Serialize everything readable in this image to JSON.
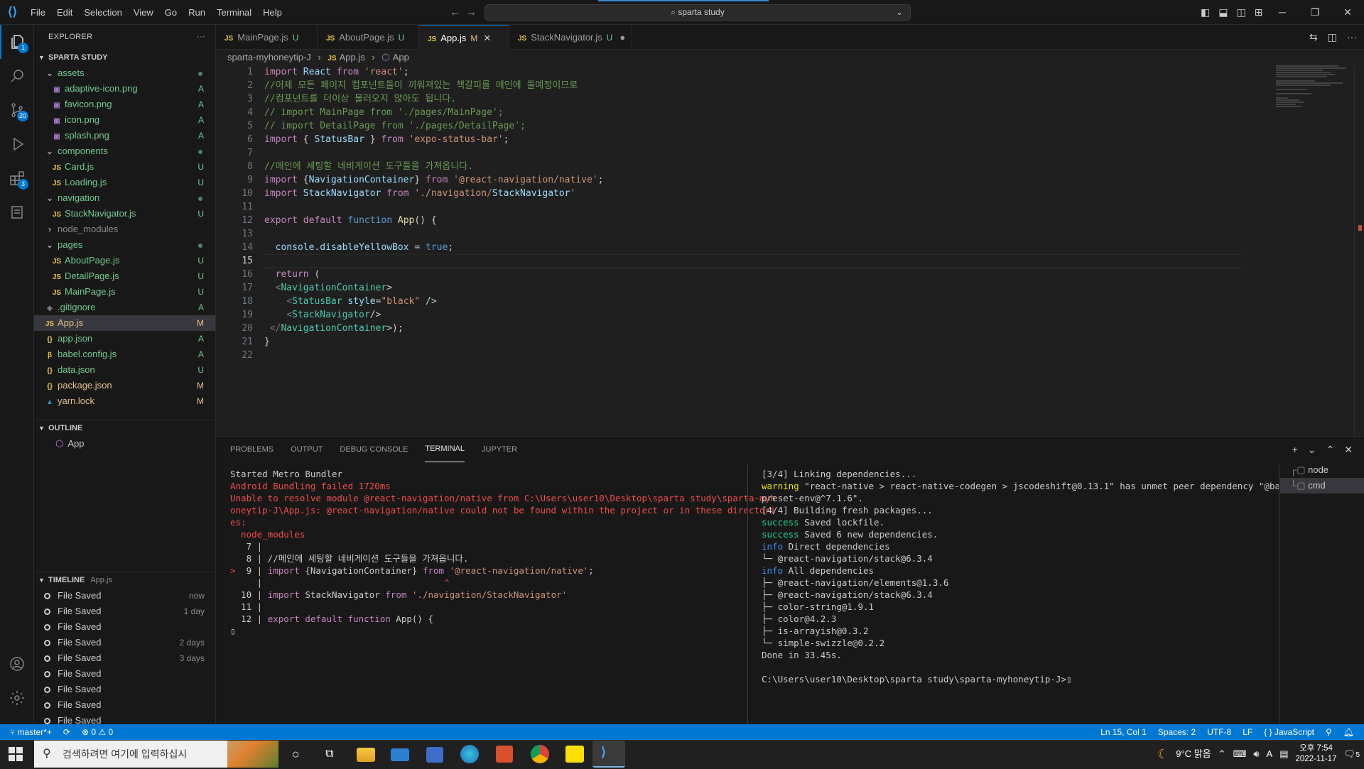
{
  "titlebar": {
    "menu": [
      "File",
      "Edit",
      "Selection",
      "View",
      "Go",
      "Run",
      "Terminal",
      "Help"
    ],
    "search_text": "sparta study"
  },
  "activity": {
    "explorer_badge": "1",
    "scm_badge": "20",
    "extensions_badge": "3"
  },
  "explorer": {
    "header": "EXPLORER",
    "section": "SPARTA STUDY",
    "files": [
      {
        "name": "assets",
        "icon": "folder",
        "status": "dot",
        "indent": 1,
        "kind": "folder-open"
      },
      {
        "name": "adaptive-icon.png",
        "icon": "png",
        "status": "A",
        "indent": 2
      },
      {
        "name": "favicon.png",
        "icon": "png",
        "status": "A",
        "indent": 2
      },
      {
        "name": "icon.png",
        "icon": "png",
        "status": "A",
        "indent": 2
      },
      {
        "name": "splash.png",
        "icon": "png",
        "status": "A",
        "indent": 2
      },
      {
        "name": "components",
        "icon": "folder",
        "status": "dot",
        "indent": 1,
        "kind": "folder-open"
      },
      {
        "name": "Card.js",
        "icon": "js",
        "status": "U",
        "indent": 2
      },
      {
        "name": "Loading.js",
        "icon": "js",
        "status": "U",
        "indent": 2
      },
      {
        "name": "navigation",
        "icon": "folder",
        "status": "dot",
        "indent": 1,
        "kind": "folder-open"
      },
      {
        "name": "StackNavigator.js",
        "icon": "js",
        "status": "U",
        "indent": 2
      },
      {
        "name": "node_modules",
        "icon": "folder",
        "status": "",
        "indent": 1,
        "kind": "folder-closed"
      },
      {
        "name": "pages",
        "icon": "folder",
        "status": "dot",
        "indent": 1,
        "kind": "folder-open"
      },
      {
        "name": "AboutPage.js",
        "icon": "js",
        "status": "U",
        "indent": 2
      },
      {
        "name": "DetailPage.js",
        "icon": "js",
        "status": "U",
        "indent": 2
      },
      {
        "name": "MainPage.js",
        "icon": "js",
        "status": "U",
        "indent": 2
      },
      {
        "name": ".gitignore",
        "icon": "git",
        "status": "A",
        "indent": 1
      },
      {
        "name": "App.js",
        "icon": "js",
        "status": "M",
        "indent": 1,
        "selected": true
      },
      {
        "name": "app.json",
        "icon": "json",
        "status": "A",
        "indent": 1
      },
      {
        "name": "babel.config.js",
        "icon": "babel",
        "status": "A",
        "indent": 1
      },
      {
        "name": "data.json",
        "icon": "json",
        "status": "U",
        "indent": 1
      },
      {
        "name": "package.json",
        "icon": "json",
        "status": "M",
        "indent": 1
      },
      {
        "name": "yarn.lock",
        "icon": "yarn",
        "status": "M",
        "indent": 1
      }
    ],
    "outline_header": "OUTLINE",
    "outline_item": "App",
    "timeline_header": "TIMELINE",
    "timeline_file": "App.js",
    "timeline": [
      {
        "label": "File Saved",
        "when": "now"
      },
      {
        "label": "File Saved",
        "when": "1 day"
      },
      {
        "label": "File Saved",
        "when": ""
      },
      {
        "label": "File Saved",
        "when": "2 days"
      },
      {
        "label": "File Saved",
        "when": "3 days"
      },
      {
        "label": "File Saved",
        "when": ""
      },
      {
        "label": "File Saved",
        "when": ""
      },
      {
        "label": "File Saved",
        "when": ""
      },
      {
        "label": "File Saved",
        "when": ""
      }
    ]
  },
  "tabs": [
    {
      "name": "MainPage.js",
      "status": "U"
    },
    {
      "name": "AboutPage.js",
      "status": "U"
    },
    {
      "name": "App.js",
      "status": "M",
      "active": true
    },
    {
      "name": "StackNavigator.js",
      "status": "U",
      "dirty": true
    }
  ],
  "breadcrumb": [
    "sparta-myhoneytip-J",
    "App.js",
    "App"
  ],
  "editor": {
    "current_line": 15,
    "lines": [
      "import React from 'react';",
      "//이제 모든 페이지 컴포넌트들이 끼워져있는 책갈피를 메인에 둘예정이므로",
      "//컴포넌트를 더이상 불러오지 않아도 됩니다.",
      "// import MainPage from './pages/MainPage';",
      "// import DetailPage from './pages/DetailPage';",
      "import { StatusBar } from 'expo-status-bar';",
      "",
      "//메인에 세팅할 네비게이션 도구들을 가져옵니다.",
      "import {NavigationContainer} from '@react-navigation/native';",
      "import StackNavigator from './navigation/StackNavigator'",
      "",
      "export default function App() {",
      "",
      "  console.disableYellowBox = true;",
      "",
      "  return (",
      "  <NavigationContainer>",
      "    <StatusBar style=\"black\" />",
      "    <StackNavigator/>",
      " </NavigationContainer>);",
      "}",
      ""
    ]
  },
  "panel": {
    "tabs": [
      "PROBLEMS",
      "OUTPUT",
      "DEBUG CONSOLE",
      "TERMINAL",
      "JUPYTER"
    ],
    "active_tab": "TERMINAL",
    "term_left": [
      {
        "t": "Started Metro Bundler",
        "c": ""
      },
      {
        "t": "Android Bundling failed 1720ms",
        "c": "red"
      },
      {
        "t": "Unable to resolve module @react-navigation/native from C:\\Users\\user10\\Desktop\\sparta study\\sparta-myh",
        "c": "red"
      },
      {
        "t": "oneytip-J\\App.js: @react-navigation/native could not be found within the project or in these directori",
        "c": "red"
      },
      {
        "t": "es:",
        "c": "red"
      },
      {
        "t": "  node_modules",
        "c": "red"
      },
      {
        "t": "   7 |",
        "c": ""
      },
      {
        "t": "   8 | //메인에 세팅할 네비게이션 도구들을 가져옵니다.",
        "c": ""
      },
      {
        "t": ">  9 | import {NavigationContainer} from '@react-navigation/native';",
        "c": ""
      },
      {
        "t": "     |                                  ^",
        "c": ""
      },
      {
        "t": "  10 | import StackNavigator from './navigation/StackNavigator'",
        "c": ""
      },
      {
        "t": "  11 |",
        "c": ""
      },
      {
        "t": "  12 | export default function App() {",
        "c": ""
      },
      {
        "t": "▯",
        "c": ""
      }
    ],
    "term_right": [
      {
        "t": "[3/4] Linking dependencies...",
        "c": ""
      },
      {
        "t": "warning \"react-native > react-native-codegen > jscodeshift@0.13.1\" has unmet peer dependency \"@babel/",
        "c": "warn"
      },
      {
        "t": "preset-env@^7.1.6\".",
        "c": ""
      },
      {
        "t": "[4/4] Building fresh packages...",
        "c": ""
      },
      {
        "t": "success Saved lockfile.",
        "c": "success"
      },
      {
        "t": "success Saved 6 new dependencies.",
        "c": "success"
      },
      {
        "t": "info Direct dependencies",
        "c": "info"
      },
      {
        "t": "└─ @react-navigation/stack@6.3.4",
        "c": ""
      },
      {
        "t": "info All dependencies",
        "c": "info"
      },
      {
        "t": "├─ @react-navigation/elements@1.3.6",
        "c": ""
      },
      {
        "t": "├─ @react-navigation/stack@6.3.4",
        "c": ""
      },
      {
        "t": "├─ color-string@1.9.1",
        "c": ""
      },
      {
        "t": "├─ color@4.2.3",
        "c": ""
      },
      {
        "t": "├─ is-arrayish@0.3.2",
        "c": ""
      },
      {
        "t": "└─ simple-swizzle@0.2.2",
        "c": ""
      },
      {
        "t": "Done in 33.45s.",
        "c": ""
      },
      {
        "t": "",
        "c": ""
      },
      {
        "t": "C:\\Users\\user10\\Desktop\\sparta study\\sparta-myhoneytip-J>▯",
        "c": ""
      }
    ],
    "terminals": [
      "node",
      "cmd"
    ]
  },
  "statusbar": {
    "branch": "master*+",
    "errors": "0",
    "warnings": "0",
    "position": "Ln 15, Col 1",
    "spaces": "Spaces: 2",
    "encoding": "UTF-8",
    "eol": "LF",
    "language": "JavaScript"
  },
  "taskbar": {
    "search_placeholder": "검색하려면 여기에 입력하십시",
    "weather": "9°C 맑음",
    "ime": "A",
    "time": "오후 7:54",
    "date": "2022-11-17",
    "notif": "5"
  },
  "colors": {
    "accent": "#0078d4",
    "untracked": "#73c991",
    "modified": "#e2c08d",
    "error": "#f14c4c"
  }
}
